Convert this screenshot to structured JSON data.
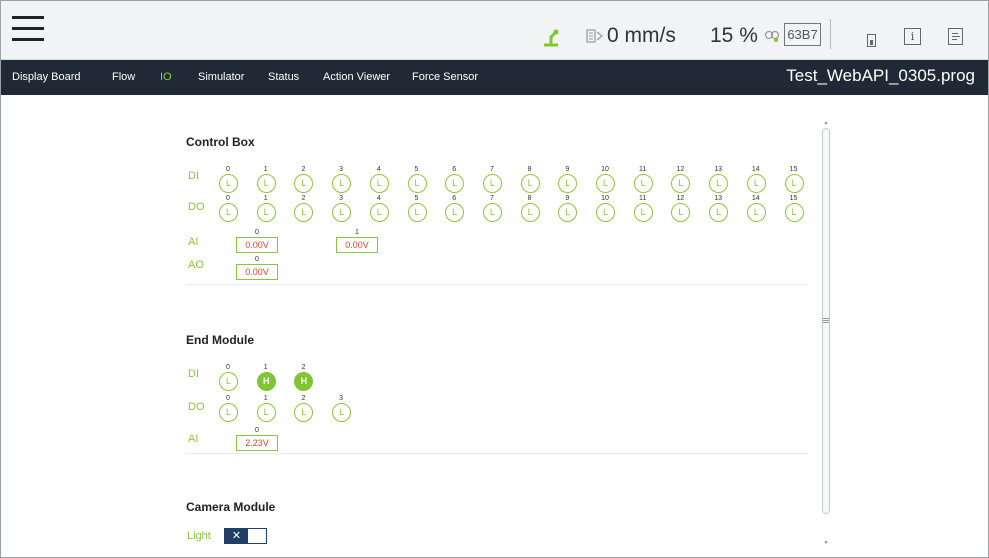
{
  "header": {
    "speed": "0 mm/s",
    "speed_percent": "15 %",
    "code": "63B7"
  },
  "nav": {
    "items": [
      "Display Board",
      "Flow",
      "IO",
      "Simulator",
      "Status",
      "Action Viewer",
      "Force Sensor"
    ],
    "active": "IO",
    "project_title": "Test_WebAPI_0305.prog"
  },
  "control_box": {
    "title": "Control Box",
    "di": {
      "label": "DI",
      "ports": [
        {
          "num": "0",
          "state": "L"
        },
        {
          "num": "1",
          "state": "L"
        },
        {
          "num": "2",
          "state": "L"
        },
        {
          "num": "3",
          "state": "L"
        },
        {
          "num": "4",
          "state": "L"
        },
        {
          "num": "5",
          "state": "L"
        },
        {
          "num": "6",
          "state": "L"
        },
        {
          "num": "7",
          "state": "L"
        },
        {
          "num": "8",
          "state": "L"
        },
        {
          "num": "9",
          "state": "L"
        },
        {
          "num": "10",
          "state": "L"
        },
        {
          "num": "11",
          "state": "L"
        },
        {
          "num": "12",
          "state": "L"
        },
        {
          "num": "13",
          "state": "L"
        },
        {
          "num": "14",
          "state": "L"
        },
        {
          "num": "15",
          "state": "L"
        }
      ]
    },
    "do": {
      "label": "DO",
      "ports": [
        {
          "num": "0",
          "state": "L"
        },
        {
          "num": "1",
          "state": "L"
        },
        {
          "num": "2",
          "state": "L"
        },
        {
          "num": "3",
          "state": "L"
        },
        {
          "num": "4",
          "state": "L"
        },
        {
          "num": "5",
          "state": "L"
        },
        {
          "num": "6",
          "state": "L"
        },
        {
          "num": "7",
          "state": "L"
        },
        {
          "num": "8",
          "state": "L"
        },
        {
          "num": "9",
          "state": "L"
        },
        {
          "num": "10",
          "state": "L"
        },
        {
          "num": "11",
          "state": "L"
        },
        {
          "num": "12",
          "state": "L"
        },
        {
          "num": "13",
          "state": "L"
        },
        {
          "num": "14",
          "state": "L"
        },
        {
          "num": "15",
          "state": "L"
        }
      ]
    },
    "ai": {
      "label": "AI",
      "channels": [
        {
          "num": "0",
          "value": "0.00V"
        },
        {
          "num": "1",
          "value": "0.00V"
        }
      ]
    },
    "ao": {
      "label": "AO",
      "channels": [
        {
          "num": "0",
          "value": "0.00V"
        }
      ]
    }
  },
  "end_module": {
    "title": "End Module",
    "di": {
      "label": "DI",
      "ports": [
        {
          "num": "0",
          "state": "L"
        },
        {
          "num": "1",
          "state": "H"
        },
        {
          "num": "2",
          "state": "H"
        }
      ]
    },
    "do": {
      "label": "DO",
      "ports": [
        {
          "num": "0",
          "state": "L"
        },
        {
          "num": "1",
          "state": "L"
        },
        {
          "num": "2",
          "state": "L"
        },
        {
          "num": "3",
          "state": "L"
        }
      ]
    },
    "ai": {
      "label": "AI",
      "channels": [
        {
          "num": "0",
          "value": "2.23V"
        }
      ]
    }
  },
  "camera_module": {
    "title": "Camera Module",
    "light_label": "Light",
    "light_toggle_glyph": "✕"
  },
  "colors": {
    "accent_green": "#8cc63f",
    "high_fill": "#7dc832",
    "value_red": "#e0462f",
    "nav_bg": "#1f2a36",
    "toggle_navy": "#1f3f66"
  }
}
